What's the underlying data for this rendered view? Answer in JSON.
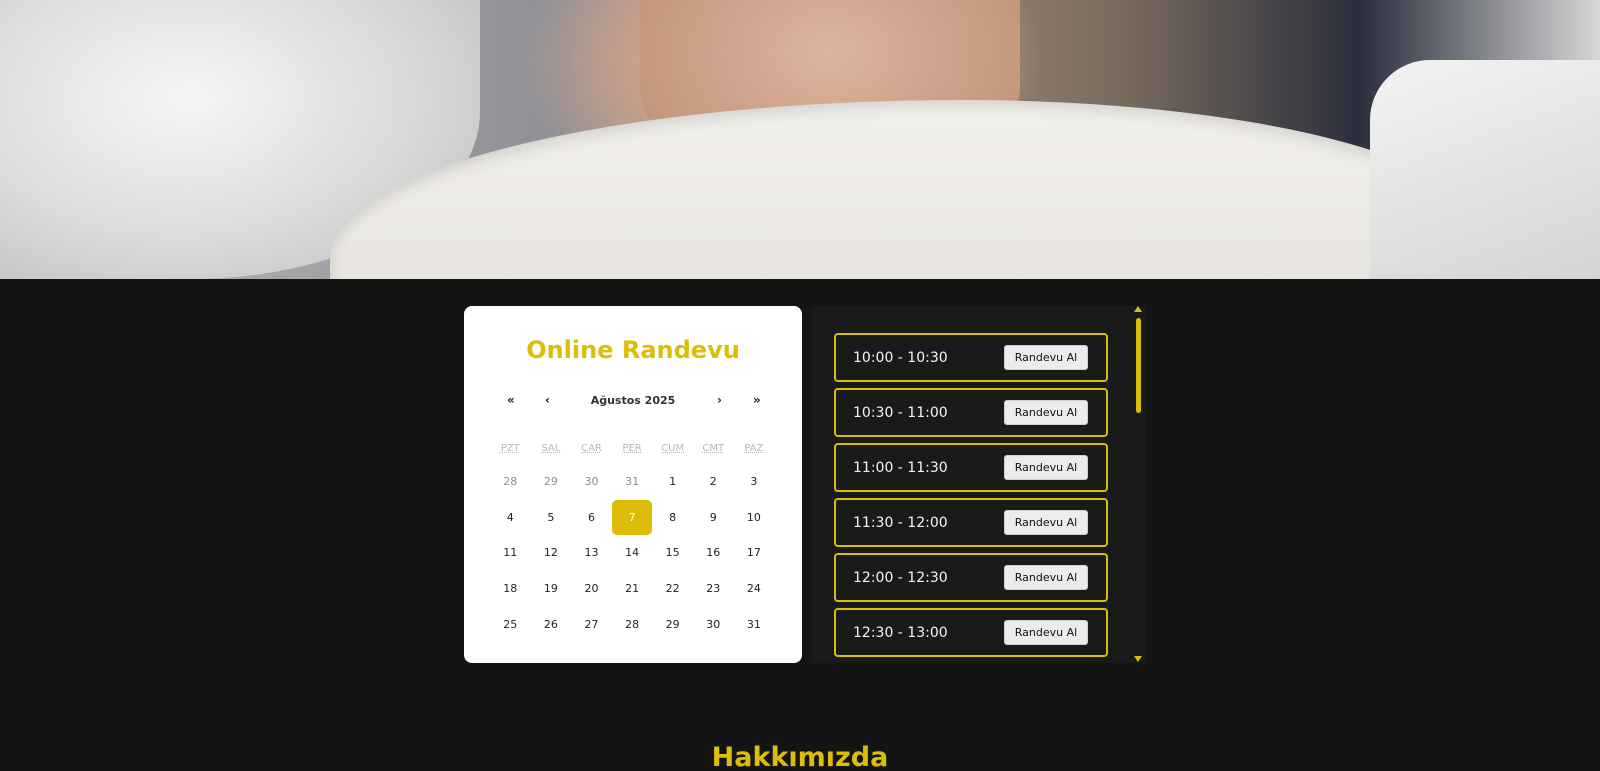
{
  "booking": {
    "title": "Online Randevu",
    "month_label": "Ağustos 2025",
    "nav": {
      "prev_year": "«",
      "prev_month": "‹",
      "next_month": "›",
      "next_year": "»"
    },
    "weekdays": [
      "PZT",
      "SAL",
      "ÇAR",
      "PER",
      "CUM",
      "CMT",
      "PAZ"
    ],
    "days": [
      {
        "d": "28",
        "muted": true
      },
      {
        "d": "29",
        "muted": true
      },
      {
        "d": "30",
        "muted": true
      },
      {
        "d": "31",
        "muted": true
      },
      {
        "d": "1"
      },
      {
        "d": "2"
      },
      {
        "d": "3"
      },
      {
        "d": "4"
      },
      {
        "d": "5"
      },
      {
        "d": "6"
      },
      {
        "d": "7",
        "selected": true
      },
      {
        "d": "8"
      },
      {
        "d": "9"
      },
      {
        "d": "10"
      },
      {
        "d": "11"
      },
      {
        "d": "12"
      },
      {
        "d": "13"
      },
      {
        "d": "14"
      },
      {
        "d": "15"
      },
      {
        "d": "16"
      },
      {
        "d": "17"
      },
      {
        "d": "18"
      },
      {
        "d": "19"
      },
      {
        "d": "20"
      },
      {
        "d": "21"
      },
      {
        "d": "22"
      },
      {
        "d": "23"
      },
      {
        "d": "24"
      },
      {
        "d": "25"
      },
      {
        "d": "26"
      },
      {
        "d": "27"
      },
      {
        "d": "28"
      },
      {
        "d": "29"
      },
      {
        "d": "30"
      },
      {
        "d": "31"
      }
    ]
  },
  "slots": [
    {
      "time": "10:00 - 10:30",
      "button": "Randevu Al"
    },
    {
      "time": "10:30 - 11:00",
      "button": "Randevu Al"
    },
    {
      "time": "11:00 - 11:30",
      "button": "Randevu Al"
    },
    {
      "time": "11:30 - 12:00",
      "button": "Randevu Al"
    },
    {
      "time": "12:00 - 12:30",
      "button": "Randevu Al"
    },
    {
      "time": "12:30 - 13:00",
      "button": "Randevu Al"
    }
  ],
  "about": {
    "heading": "Hakkımızda"
  },
  "colors": {
    "accent": "#dbbd0a",
    "background": "#141414",
    "panel": "#1a1a1a",
    "card": "#ffffff"
  }
}
